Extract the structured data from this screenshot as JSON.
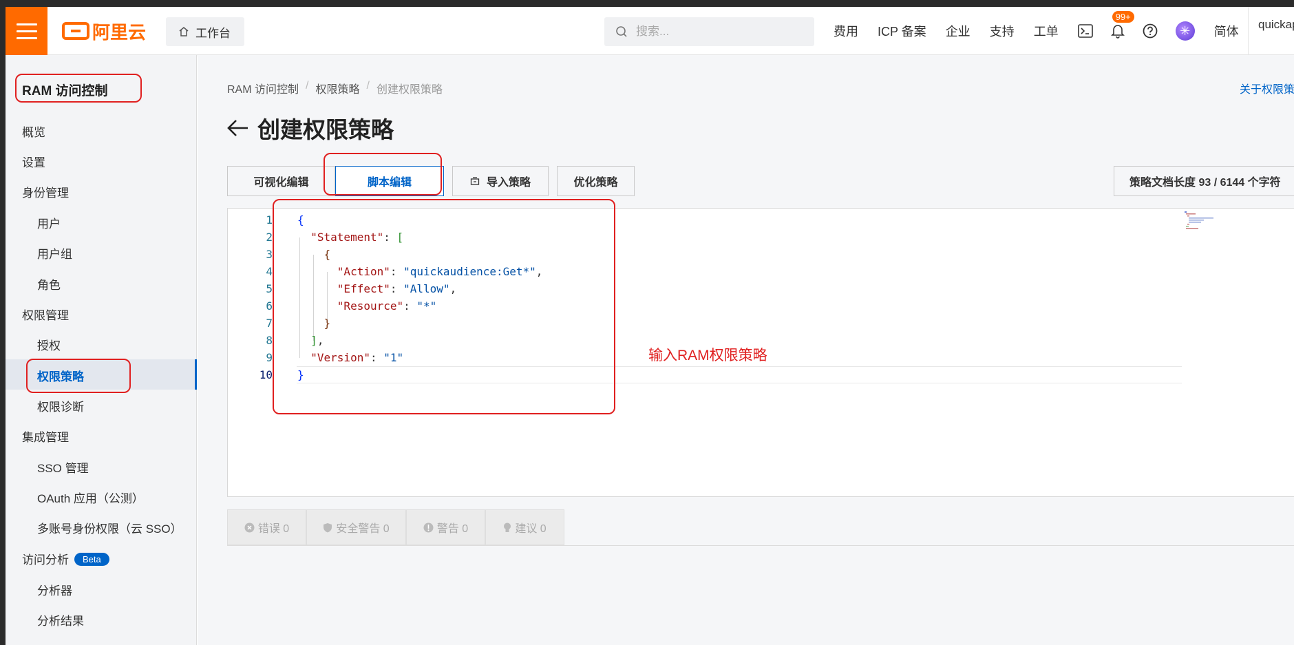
{
  "topbar": {
    "logo_text": "阿里云",
    "workbench_label": "工作台",
    "search_placeholder": "搜索...",
    "nav": [
      "费用",
      "ICP 备案",
      "企业",
      "支持",
      "工单"
    ],
    "notification_count": "99+",
    "language": "简体",
    "user": "quickap"
  },
  "sidebar": {
    "title": "RAM 访问控制",
    "items": [
      {
        "label": "概览"
      },
      {
        "label": "设置"
      },
      {
        "label": "身份管理"
      },
      {
        "label": "用户"
      },
      {
        "label": "用户组"
      },
      {
        "label": "角色"
      },
      {
        "label": "权限管理"
      },
      {
        "label": "授权"
      },
      {
        "label": "权限策略"
      },
      {
        "label": "权限诊断"
      },
      {
        "label": "集成管理"
      },
      {
        "label": "SSO 管理"
      },
      {
        "label": "OAuth 应用（公测）"
      },
      {
        "label": "多账号身份权限（云 SSO）"
      },
      {
        "label": "访问分析"
      },
      {
        "label": "分析器"
      },
      {
        "label": "分析结果"
      }
    ],
    "beta_label": "Beta"
  },
  "breadcrumb": [
    "RAM 访问控制",
    "权限策略",
    "创建权限策略"
  ],
  "help_link": "关于权限策略",
  "page_title": "创建权限策略",
  "tabs": {
    "visual": "可视化编辑",
    "script": "脚本编辑",
    "import": "导入策略",
    "optimize": "优化策略"
  },
  "doc_length": "策略文档长度 93 / 6144 个字符",
  "editor": {
    "line_numbers": [
      "1",
      "2",
      "3",
      "4",
      "5",
      "6",
      "7",
      "8",
      "9",
      "10"
    ],
    "code": {
      "statement_key": "\"Statement\"",
      "action_key": "\"Action\"",
      "action_value": "\"quickaudience:Get*\"",
      "effect_key": "\"Effect\"",
      "effect_value": "\"Allow\"",
      "resource_key": "\"Resource\"",
      "resource_value": "\"*\"",
      "version_key": "\"Version\"",
      "version_value": "\"1\""
    }
  },
  "lint": {
    "errors": "错误 0",
    "security": "安全警告 0",
    "warnings": "警告 0",
    "suggestions": "建议 0"
  },
  "annotation_text": "输入RAM权限策略",
  "colors": {
    "brand": "#ff6a00",
    "accent": "#0064c8",
    "annotation": "#e02020"
  }
}
